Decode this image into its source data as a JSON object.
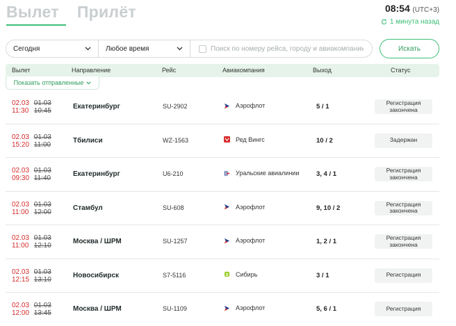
{
  "tabs": {
    "departure": "Вылет",
    "arrival": "Прилёт"
  },
  "clock": {
    "time": "08:54",
    "timezone": "(UTC+3)",
    "updated": "1 минута назад"
  },
  "filters": {
    "date": "Сегодня",
    "time": "Любое время",
    "search_placeholder": "Поиск по номеру рейса, городу и авиакомпании",
    "search_button": "Искать"
  },
  "table": {
    "headers": {
      "departure": "Вылет",
      "direction": "Направление",
      "flight": "Рейс",
      "airline": "Авиакомпания",
      "gate": "Выход",
      "status": "Статус"
    },
    "show_sent": "Показать отправленные"
  },
  "colors": {
    "accent": "#3cbf76",
    "delay": "#d62b2b",
    "header_bg": "#e6f3ea"
  },
  "flights": [
    {
      "new_date": "02.03",
      "new_time": "11:30",
      "old_date": "01.03",
      "old_time": "10:45",
      "destination": "Екатеринбург",
      "flight": "SU-2902",
      "airline": "Аэрофлот",
      "logo": "aeroflot",
      "gate": "5 / 1",
      "status": "Регистрация закончена"
    },
    {
      "new_date": "02.03",
      "new_time": "15:20",
      "old_date": "01.03",
      "old_time": "11:00",
      "destination": "Тбилиси",
      "flight": "WZ-1563",
      "airline": "Ред Вингс",
      "logo": "redwings",
      "gate": "10 / 2",
      "status": "Задержан"
    },
    {
      "new_date": "02.03",
      "new_time": "09:30",
      "old_date": "01.03",
      "old_time": "11:40",
      "destination": "Екатеринбург",
      "flight": "U6-210",
      "airline": "Уральские авиалинии",
      "logo": "ural",
      "gate": "3, 4 / 1",
      "status": "Регистрация закончена"
    },
    {
      "new_date": "02.03",
      "new_time": "11:00",
      "old_date": "01.03",
      "old_time": "12:00",
      "destination": "Стамбул",
      "flight": "SU-608",
      "airline": "Аэрофлот",
      "logo": "aeroflot",
      "gate": "9, 10 / 2",
      "status": "Регистрация закончена"
    },
    {
      "new_date": "02.03",
      "new_time": "11:00",
      "old_date": "01.03",
      "old_time": "12:10",
      "destination": "Москва / ШРМ",
      "flight": "SU-1257",
      "airline": "Аэрофлот",
      "logo": "aeroflot",
      "gate": "1, 2 / 1",
      "status": "Регистрация закончена"
    },
    {
      "new_date": "02.03",
      "new_time": "12:15",
      "old_date": "01.03",
      "old_time": "13:10",
      "destination": "Новосибирск",
      "flight": "S7-5116",
      "airline": "Сибирь",
      "logo": "s7",
      "gate": "3 / 1",
      "status": "Регистрация"
    },
    {
      "new_date": "02.03",
      "new_time": "12:00",
      "old_date": "01.03",
      "old_time": "13:45",
      "destination": "Москва / ШРМ",
      "flight": "SU-1109",
      "airline": "Аэрофлот",
      "logo": "aeroflot",
      "gate": "5, 6 / 1",
      "status": "Регистрация"
    }
  ]
}
